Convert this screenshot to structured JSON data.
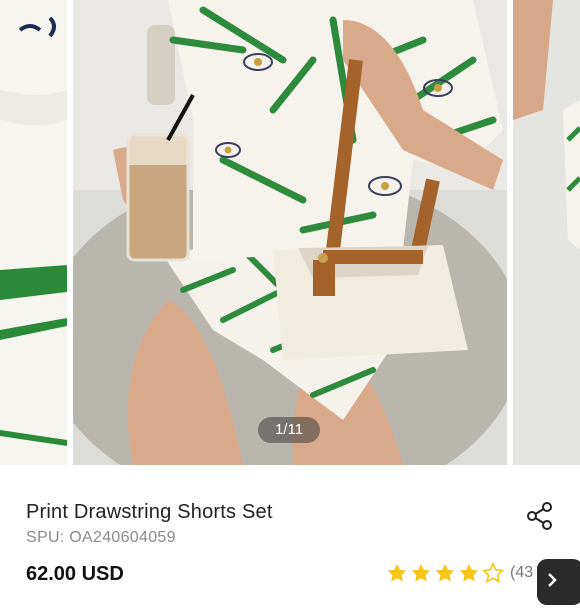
{
  "gallery": {
    "counter": "1/11"
  },
  "product": {
    "title": "Print Drawstring Shorts Set",
    "spu": "SPU: OA240604059",
    "price": "62.00 USD"
  },
  "rating": {
    "stars": 4,
    "max": 5,
    "count_text": "(43"
  },
  "icons": {
    "share": "share-icon",
    "star": "star-icon",
    "chevron": "chevron-right-icon"
  },
  "colors": {
    "star": "#f5c518",
    "print_green": "#2e8b3d",
    "bag_cream": "#f1ece0",
    "strap_brown": "#a5632c"
  }
}
